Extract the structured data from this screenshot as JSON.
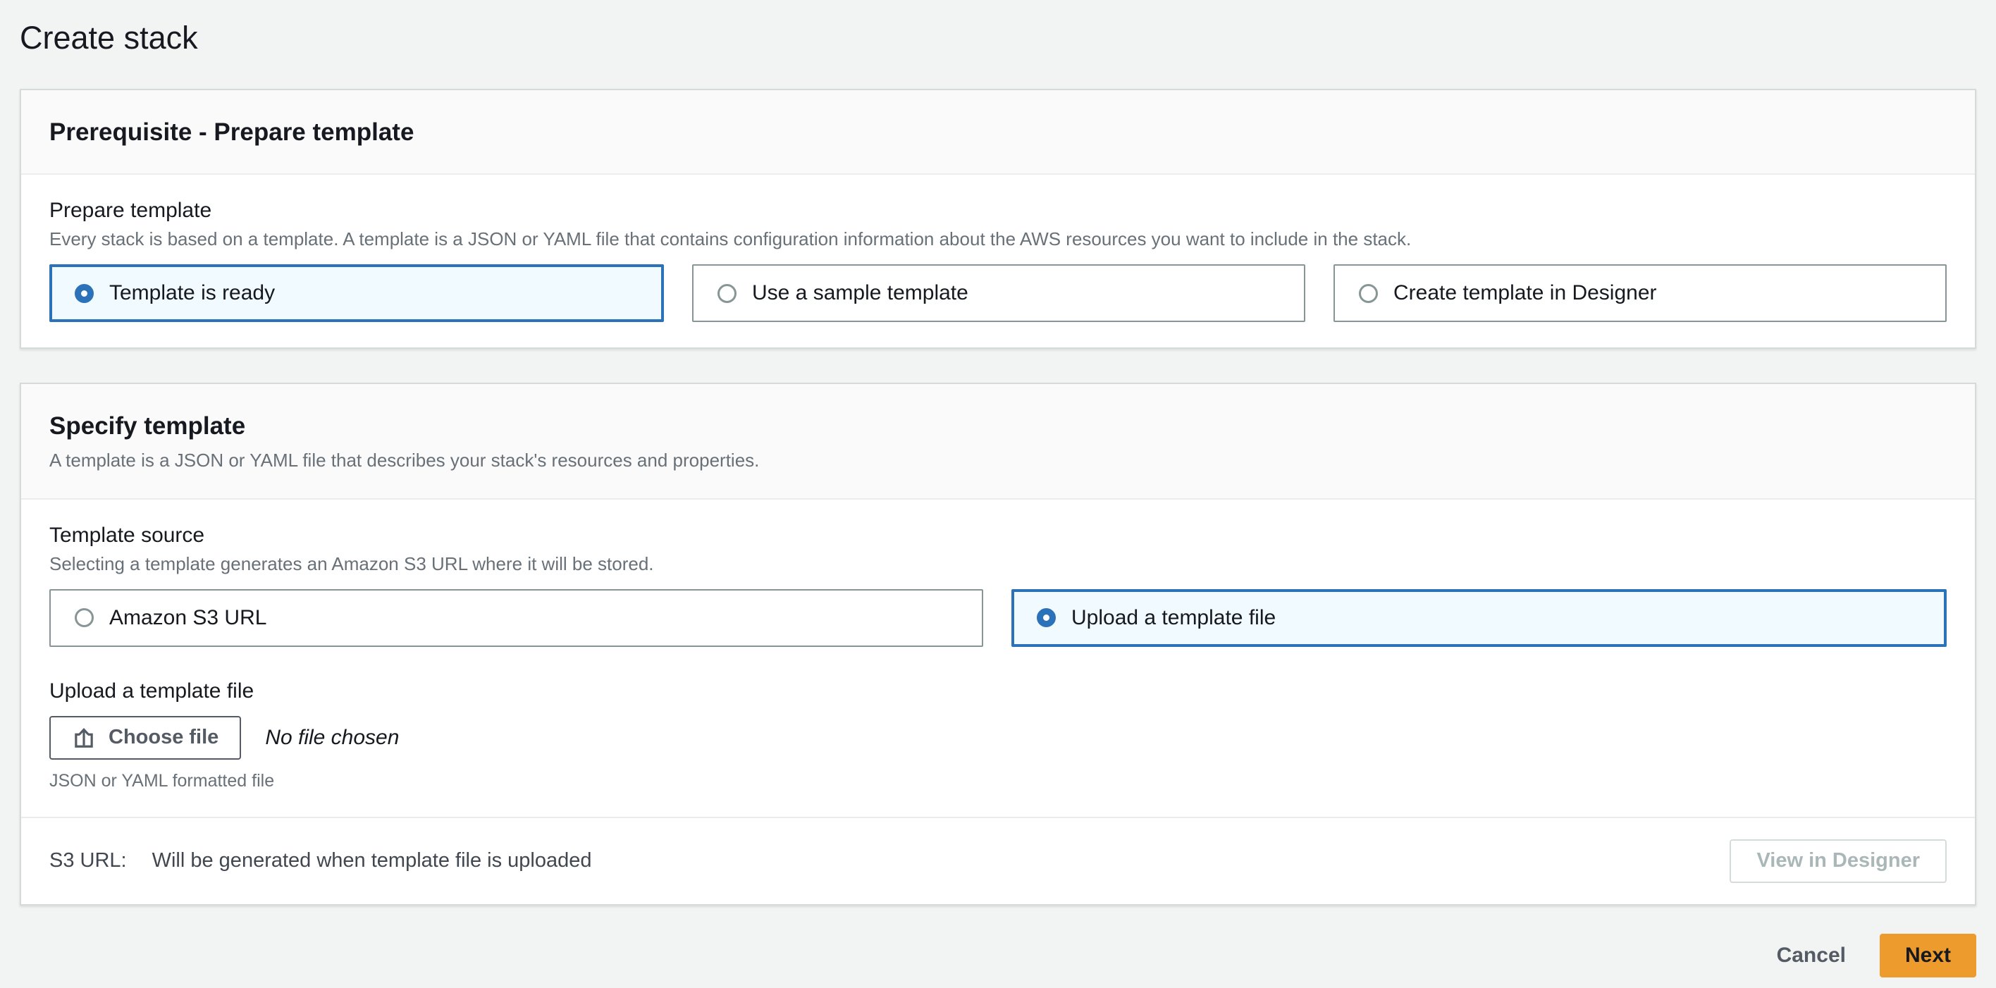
{
  "page": {
    "title": "Create stack"
  },
  "prerequisite": {
    "header": "Prerequisite - Prepare template",
    "field_label": "Prepare template",
    "field_description": "Every stack is based on a template. A template is a JSON or YAML file that contains configuration information about the AWS resources you want to include in the stack.",
    "options": [
      {
        "label": "Template is ready",
        "selected": true
      },
      {
        "label": "Use a sample template",
        "selected": false
      },
      {
        "label": "Create template in Designer",
        "selected": false
      }
    ]
  },
  "specify": {
    "header": "Specify template",
    "subtitle": "A template is a JSON or YAML file that describes your stack's resources and properties.",
    "source": {
      "label": "Template source",
      "description": "Selecting a template generates an Amazon S3 URL where it will be stored.",
      "options": [
        {
          "label": "Amazon S3 URL",
          "selected": false
        },
        {
          "label": "Upload a template file",
          "selected": true
        }
      ]
    },
    "upload": {
      "label": "Upload a template file",
      "choose_button_label": "Choose file",
      "choose_button_icon": "upload-icon",
      "file_status": "No file chosen",
      "constraint": "JSON or YAML formatted file"
    },
    "footer": {
      "s3_label": "S3 URL:",
      "s3_value": "Will be generated when template file is uploaded",
      "view_designer_label": "View in Designer",
      "view_designer_enabled": false
    }
  },
  "actions": {
    "cancel_label": "Cancel",
    "next_label": "Next"
  },
  "colors": {
    "page_bg": "#f2f3f3",
    "accent_blue": "#2b72b9",
    "selected_tile_bg": "#f1faff",
    "next_button_orange": "#ee9b2e",
    "text_primary": "#16191f",
    "text_secondary": "#687078",
    "disabled_text": "#aab7b8"
  }
}
